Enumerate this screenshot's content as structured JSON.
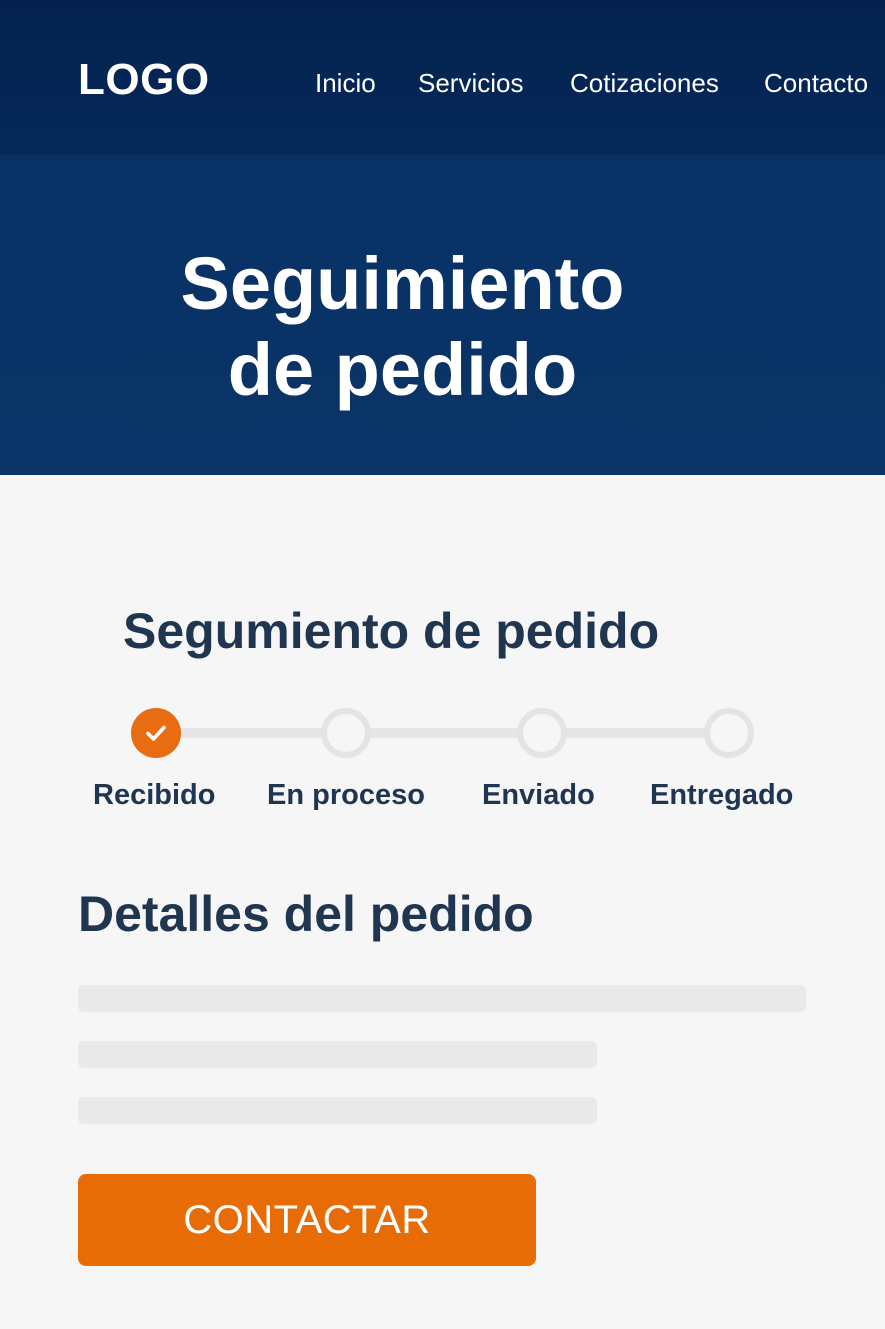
{
  "header": {
    "logo": "LOGO",
    "nav": [
      {
        "label": "Inicio"
      },
      {
        "label": "Servicios"
      },
      {
        "label": "Cotizaciones"
      },
      {
        "label": "Contacto"
      }
    ]
  },
  "hero": {
    "title_line1": "Seguimiento",
    "title_line2": "de pedido"
  },
  "tracking": {
    "title": "Segumiento de pedido",
    "steps": [
      {
        "label": "Recibido",
        "status": "done"
      },
      {
        "label": "En proceso",
        "status": "pending"
      },
      {
        "label": "Enviado",
        "status": "pending"
      },
      {
        "label": "Entregado",
        "status": "pending"
      }
    ],
    "accent_color": "#e86c12"
  },
  "details": {
    "title": "Detalles del pedido"
  },
  "actions": {
    "contact_label": "CONTACTAR"
  },
  "colors": {
    "nav_bg": "#04214d",
    "hero_bg": "#083165",
    "heading": "#1f3550",
    "button": "#e86c06"
  }
}
